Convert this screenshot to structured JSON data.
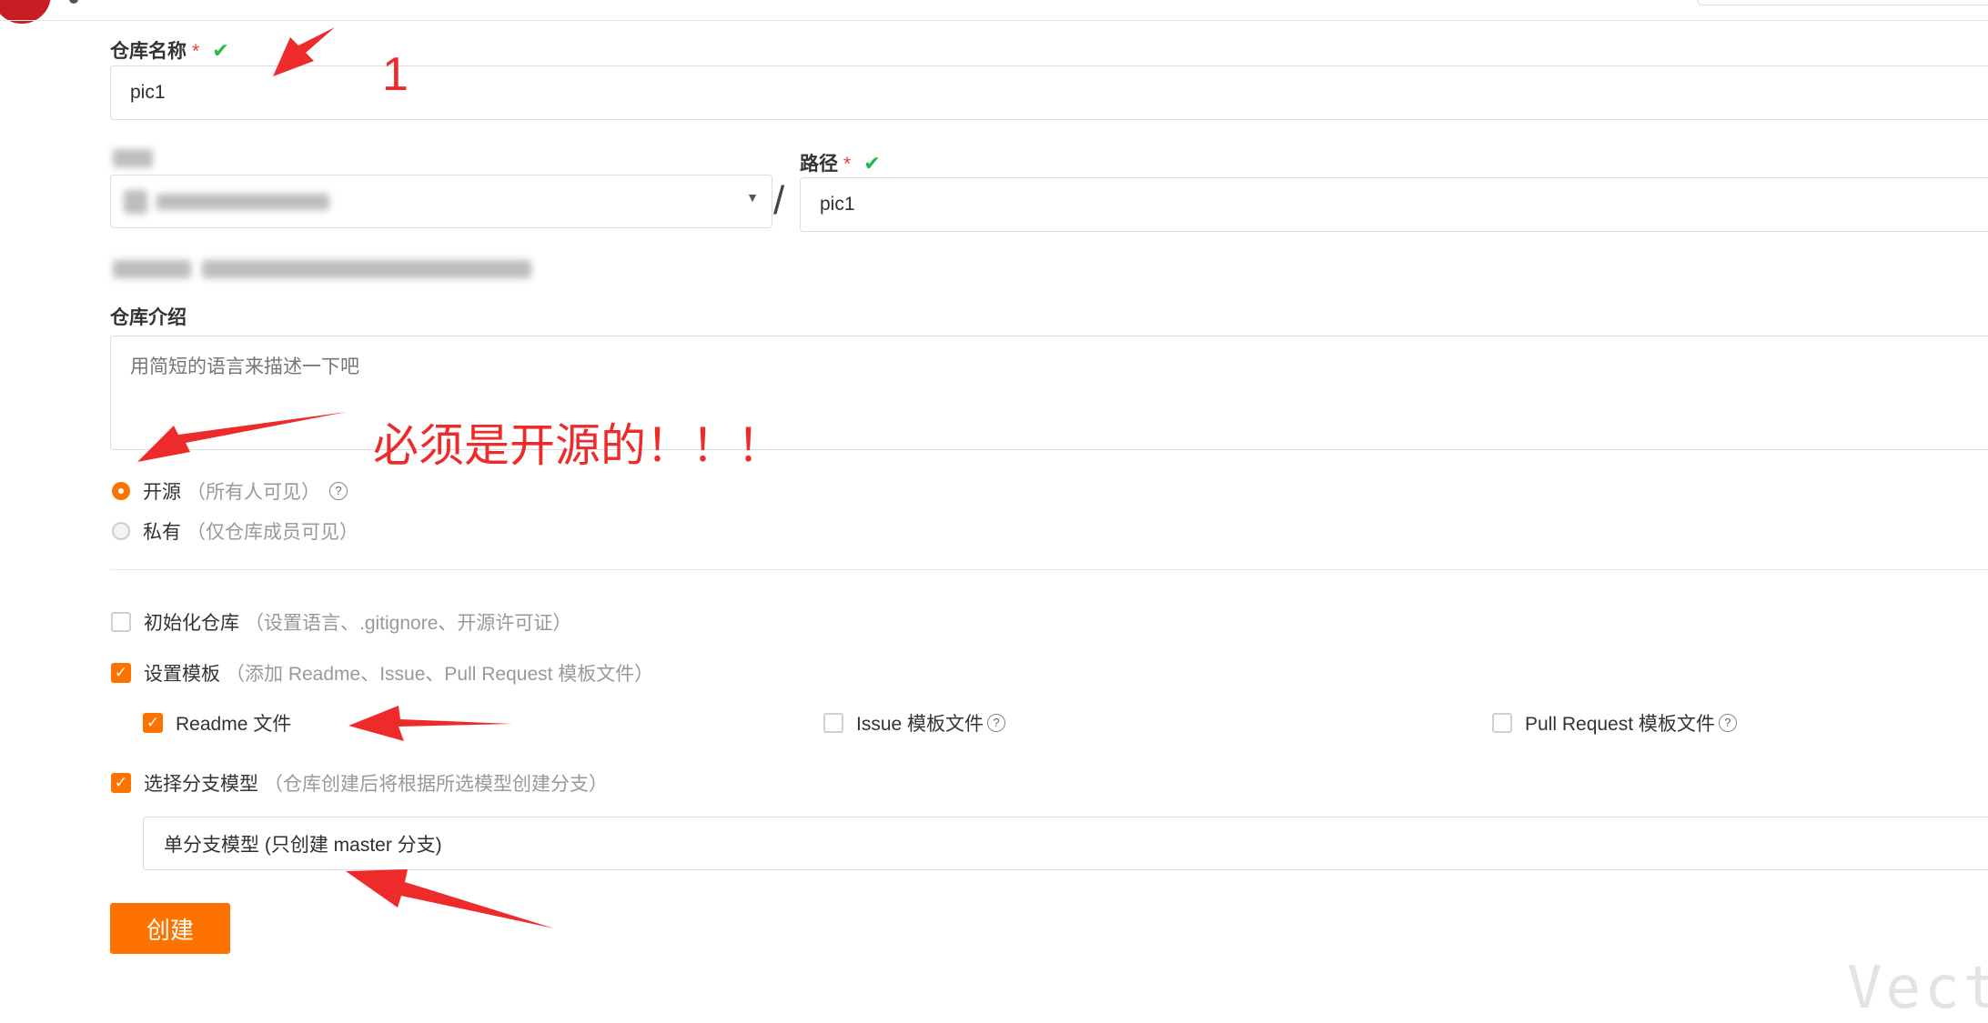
{
  "form": {
    "repo_name": {
      "label": "仓库名称",
      "required_mark": "*",
      "value": "pic1"
    },
    "path": {
      "label": "路径",
      "required_mark": "*",
      "value": "pic1",
      "separator": "/"
    },
    "intro": {
      "label": "仓库介绍",
      "placeholder": "用简短的语言来描述一下吧"
    },
    "visibility": {
      "public": {
        "label": "开源",
        "hint": "（所有人可见）",
        "selected": true
      },
      "private": {
        "label": "私有",
        "hint": "（仅仓库成员可见）",
        "selected": false
      }
    },
    "init_repo": {
      "label": "初始化仓库",
      "hint": "（设置语言、.gitignore、开源许可证）",
      "checked": false
    },
    "templates": {
      "label": "设置模板",
      "hint": "（添加 Readme、Issue、Pull Request 模板文件）",
      "checked": true,
      "readme": {
        "label": "Readme 文件",
        "checked": true
      },
      "issue": {
        "label": "Issue 模板文件",
        "checked": false
      },
      "pull_request": {
        "label": "Pull Request 模板文件",
        "checked": false
      }
    },
    "branch_model": {
      "label": "选择分支模型",
      "hint": "（仓库创建后将根据所选模型创建分支）",
      "checked": true,
      "selected": "单分支模型 (只创建 master 分支)"
    },
    "create_button": "创建"
  },
  "annotations": {
    "number": "1",
    "note": "必须是开源的！！！",
    "color": "#ee2b2b"
  },
  "watermark": "Vect",
  "colors": {
    "accent": "#fe7300",
    "required": "#e4393c",
    "check": "#21ba45"
  }
}
